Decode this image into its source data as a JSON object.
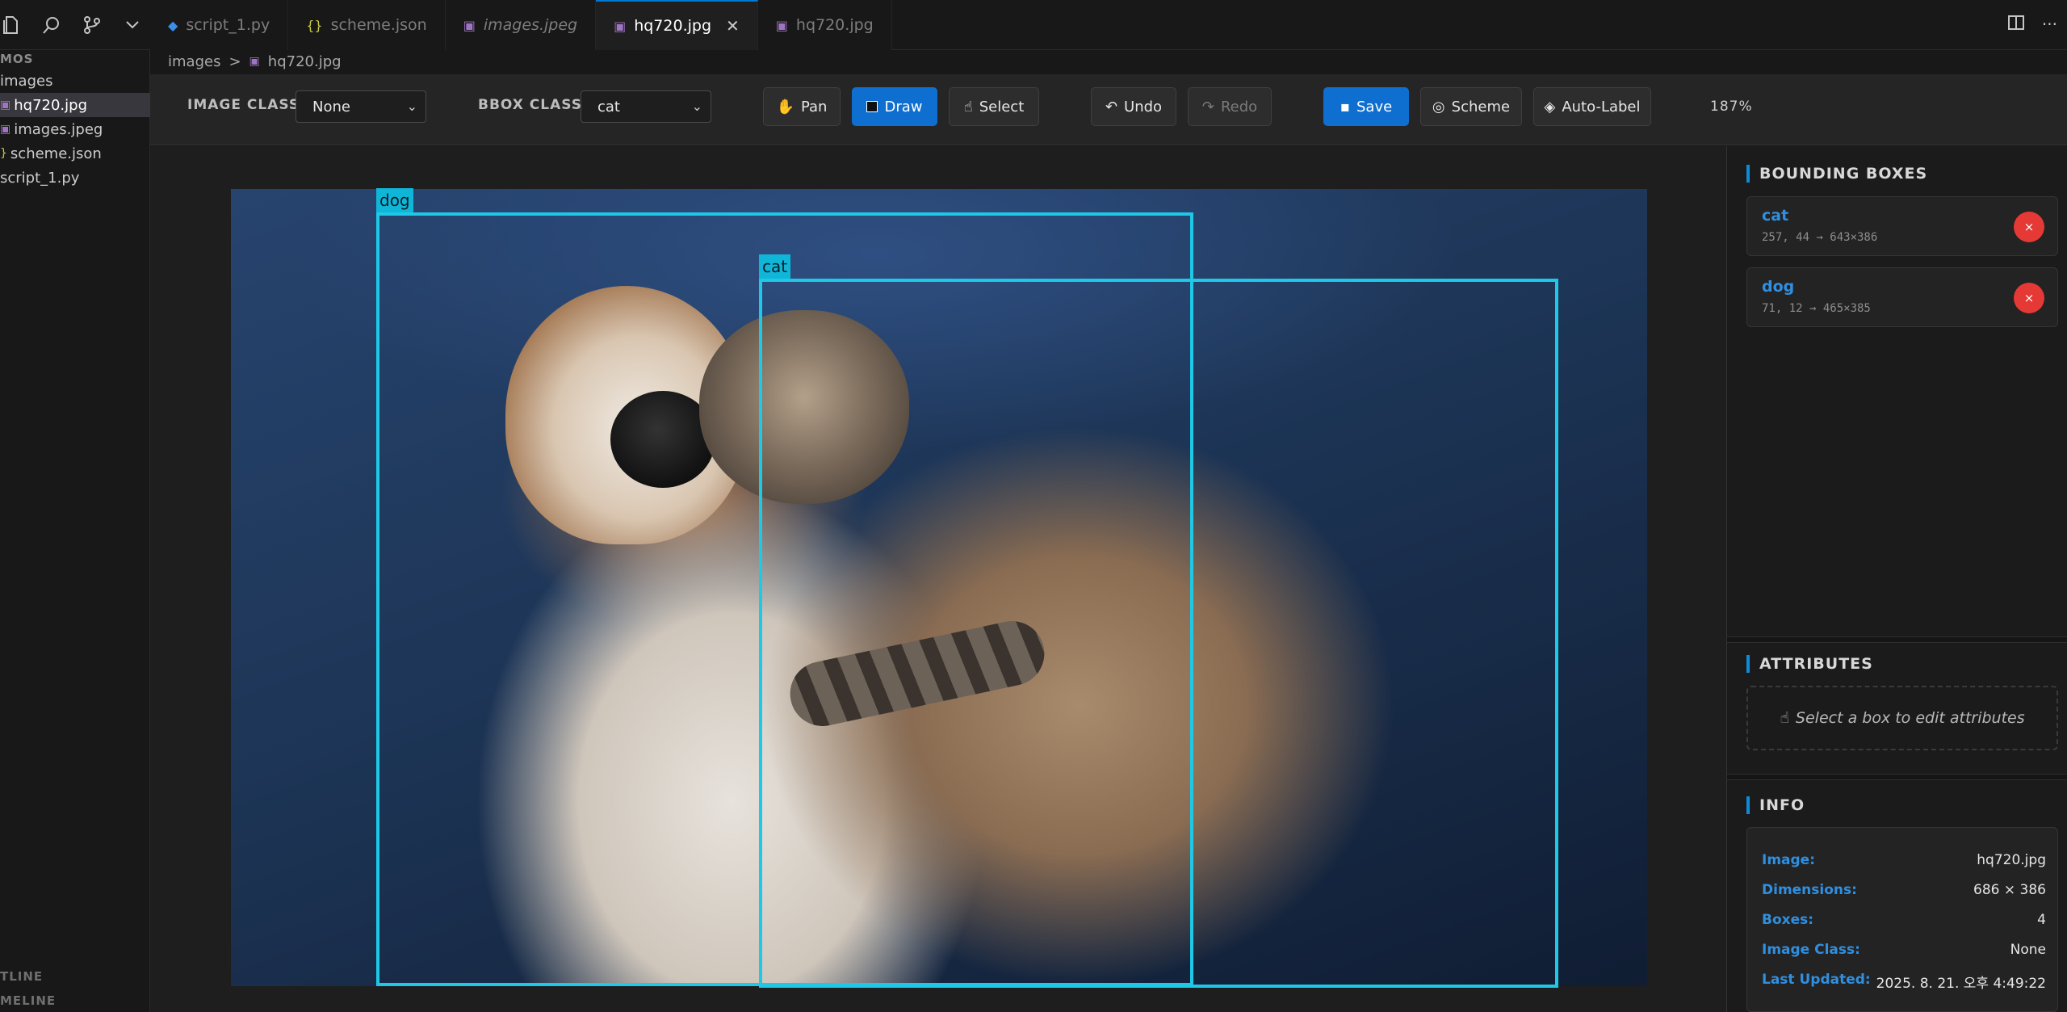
{
  "activity": {
    "icons": [
      "files-icon",
      "search-icon",
      "source-control-icon",
      "chevron-down-icon"
    ]
  },
  "tabs": [
    {
      "label": "script_1.py",
      "icon": "python-file-icon",
      "italic": false,
      "active": false
    },
    {
      "label": "scheme.json",
      "icon": "json-file-icon",
      "italic": false,
      "active": false
    },
    {
      "label": "images.jpeg",
      "icon": "image-file-icon",
      "italic": true,
      "active": false
    },
    {
      "label": "hq720.jpg",
      "icon": "image-file-icon",
      "italic": false,
      "active": true
    },
    {
      "label": "hq720.jpg",
      "icon": "image-file-icon",
      "italic": false,
      "active": false
    }
  ],
  "sidebar": {
    "header": "MOS",
    "items": [
      {
        "label": "images"
      },
      {
        "label": "hq720.jpg"
      },
      {
        "label": "images.jpeg"
      },
      {
        "label": "scheme.json"
      },
      {
        "label": "script_1.py"
      }
    ],
    "outline": "TLINE",
    "timeline": "MELINE"
  },
  "breadcrumb": {
    "folder": "images",
    "separator": ">",
    "file": "hq720.jpg"
  },
  "toolbar": {
    "image_class_label": "IMAGE CLASS",
    "image_class_value": "None",
    "bbox_class_label": "BBOX CLASS",
    "bbox_class_value": "cat",
    "pan_label": "Pan",
    "draw_label": "Draw",
    "select_label": "Select",
    "undo_label": "Undo",
    "redo_label": "Redo",
    "save_label": "Save",
    "scheme_label": "Scheme",
    "autolabel_label": "Auto-Label",
    "zoom": "187%"
  },
  "canvas": {
    "boxes": [
      {
        "label": "dog"
      },
      {
        "label": "cat"
      }
    ]
  },
  "panel": {
    "bbox_title": "BOUNDING BOXES",
    "boxes": [
      {
        "name": "cat",
        "meta": "257, 44 → 643×386",
        "delete": "×"
      },
      {
        "name": "dog",
        "meta": "71, 12 → 465×385",
        "delete": "×"
      }
    ],
    "attributes_title": "ATTRIBUTES",
    "attributes_empty": "Select a box to edit attributes",
    "info_title": "INFO",
    "info": [
      {
        "key": "Image:",
        "value": "hq720.jpg"
      },
      {
        "key": "Dimensions:",
        "value": "686 × 386"
      },
      {
        "key": "Boxes:",
        "value": "4"
      },
      {
        "key": "Image Class:",
        "value": "None"
      },
      {
        "key": "Last Updated:",
        "value": "2025. 8. 21. 오후 4:49:22"
      }
    ]
  },
  "colors": {
    "accent": "#0e6fd0",
    "bbox": "#1ec8e6",
    "delete": "#e53935",
    "link": "#2f8fe0"
  }
}
